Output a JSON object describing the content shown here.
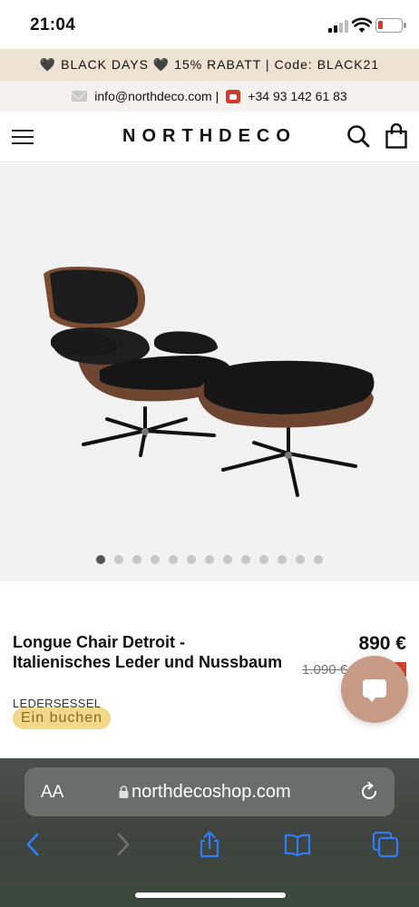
{
  "status_bar": {
    "time": "21:04"
  },
  "promo": {
    "text": "🖤 BLACK DAYS 🖤 15% RABATT | Code: BLACK21"
  },
  "contact": {
    "email": "info@northdeco.com",
    "separator": "|",
    "phone": "+34 93 142 61 83"
  },
  "header": {
    "logo": "NORTHDECO"
  },
  "gallery": {
    "image_count": 13,
    "active_index": 0
  },
  "product": {
    "title": "Longue Chair Detroit - Italienisches Leder und Nussbaum",
    "price": "890 €",
    "old_price": "1.090 €",
    "category": "LEDERSESSEL",
    "book_label": "Ein buchen"
  },
  "browser": {
    "aa_label": "AA",
    "url": "northdecoshop.com"
  },
  "colors": {
    "promo_bg": "#ede3d2",
    "sale_red": "#d8412f",
    "book_badge": "#f3d88b",
    "chat_button": "#c79b86",
    "ios_blue": "#2f7cf6"
  }
}
